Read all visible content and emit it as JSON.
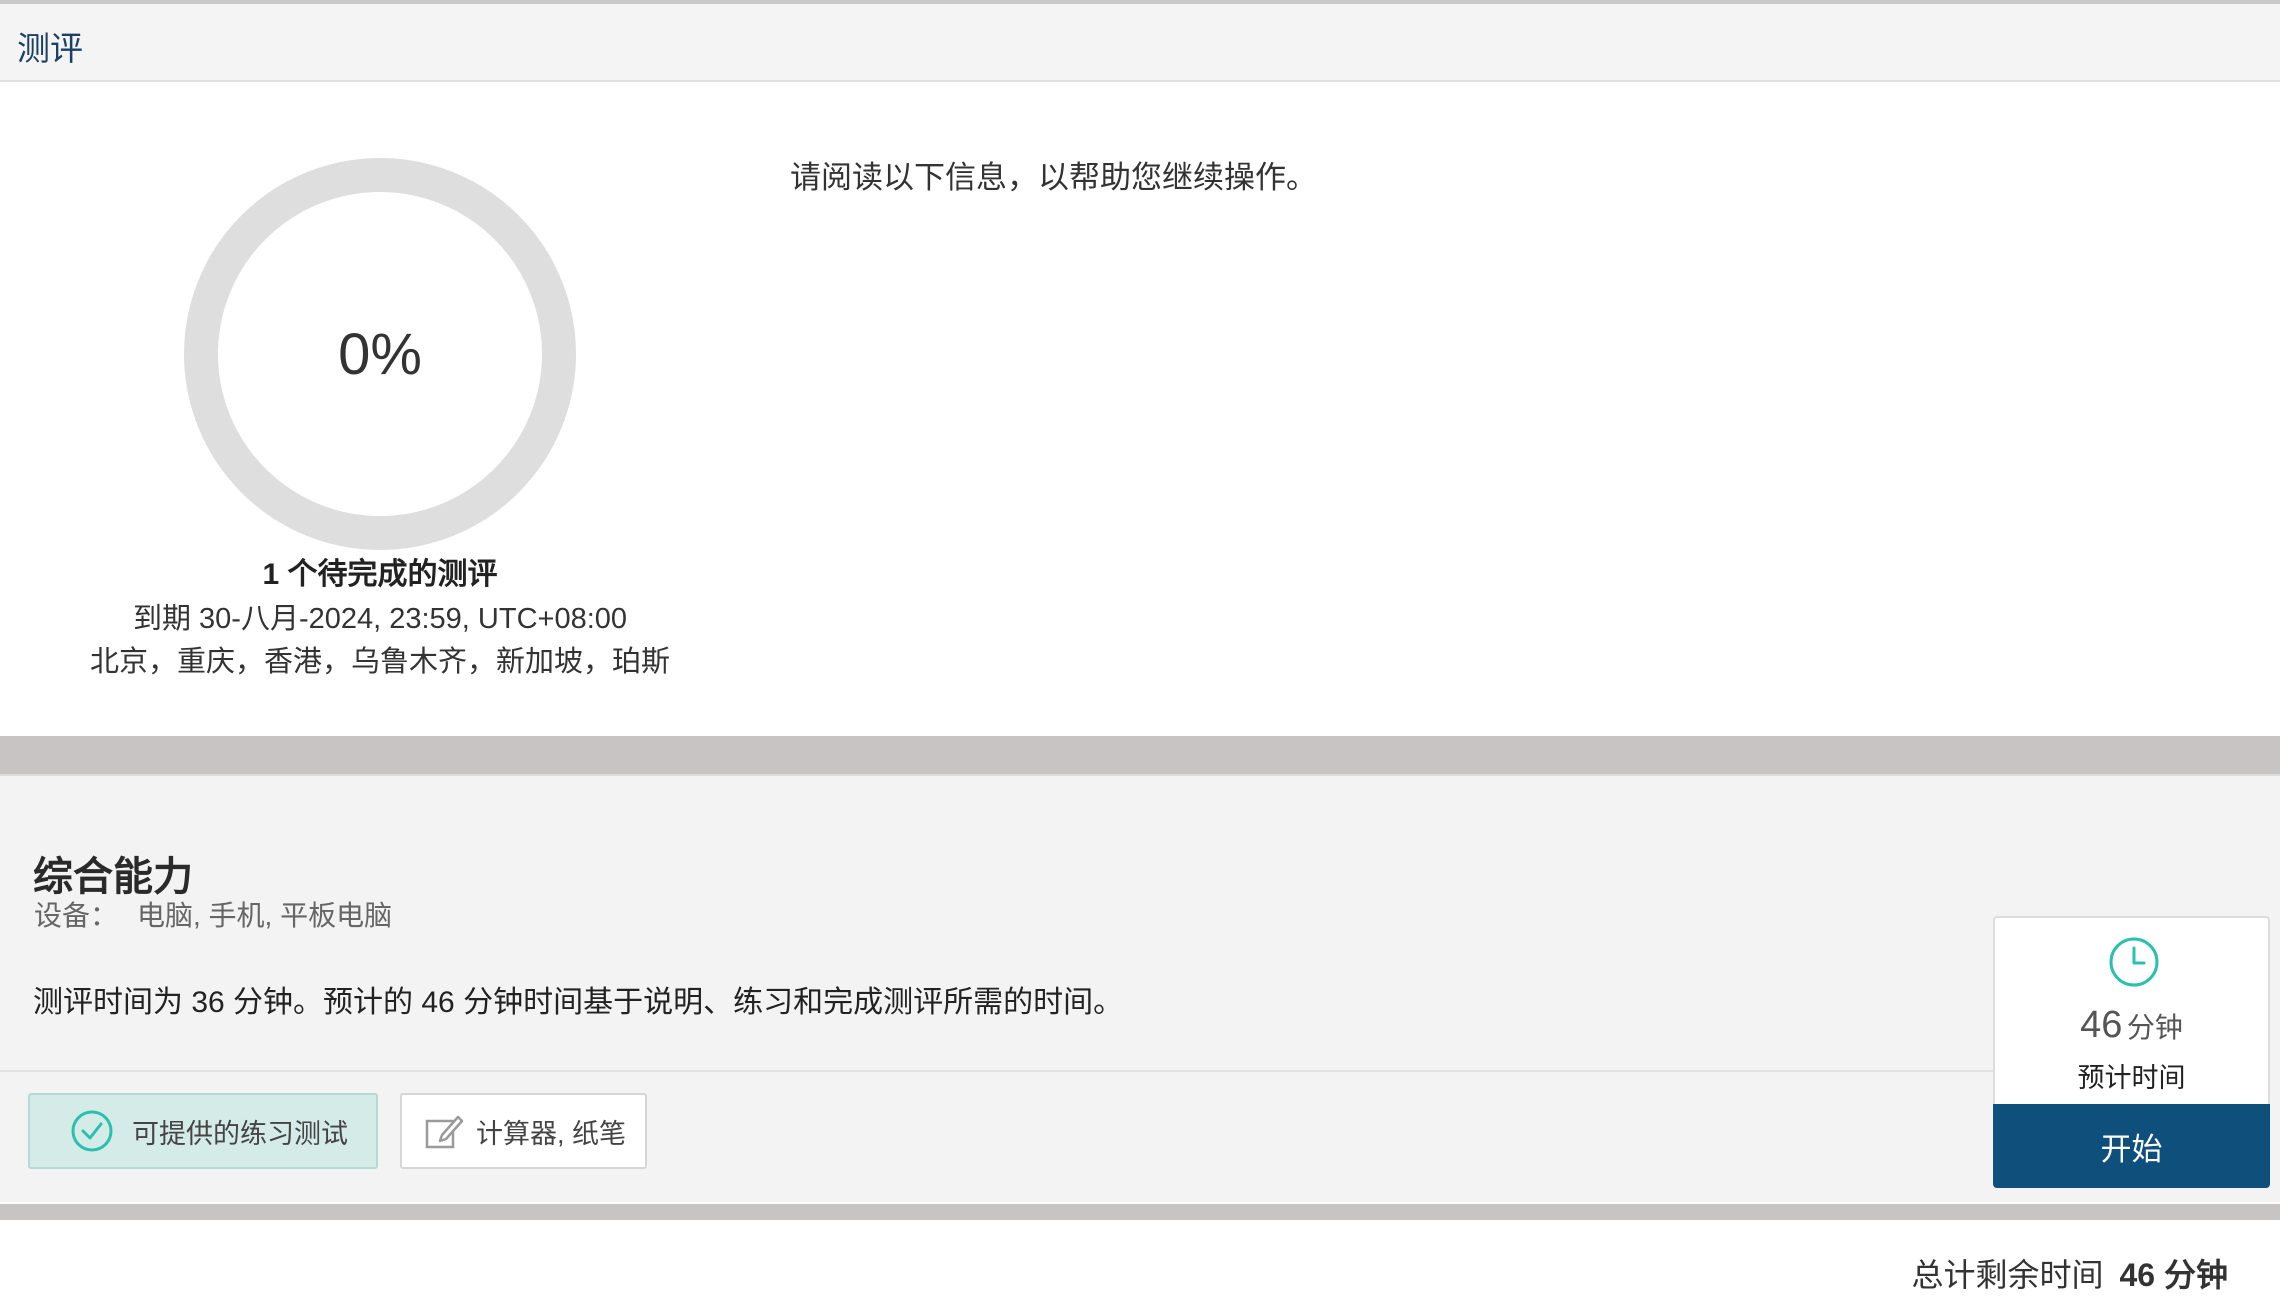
{
  "header": {
    "title": "测评"
  },
  "progress": {
    "percent_label": "0%",
    "value": 0
  },
  "summary": {
    "pending": "1 个待完成的测评",
    "due": "到期 30-八月-2024, 23:59, UTC+08:00",
    "timezone_cities": "北京，重庆，香港，乌鲁木齐，新加坡，珀斯"
  },
  "instructions": "请阅读以下信息，以帮助您继续操作。",
  "assessment": {
    "name": "综合能力",
    "device_label": "设备：",
    "device_value": "电脑, 手机, 平板电脑",
    "description": "测评时间为 36 分钟。预计的 46 分钟时间基于说明、练习和完成测评所需的时间。",
    "practice_label": "可提供的练习测试",
    "tools_label": "计算器, 纸笔",
    "estimate_number": "46",
    "estimate_unit": "分钟",
    "estimate_label": "预计时间",
    "start_label": "开始"
  },
  "footer": {
    "label": "总计剩余时间",
    "value": "46 分钟"
  },
  "icons": {
    "check": "check-circle-icon",
    "tools": "pencil-edit-icon",
    "clock": "clock-icon"
  },
  "colors": {
    "accent_teal": "#2bbfae",
    "start_button": "#0e4f7c",
    "header_title": "#1b3f66",
    "ring": "#dedede"
  }
}
